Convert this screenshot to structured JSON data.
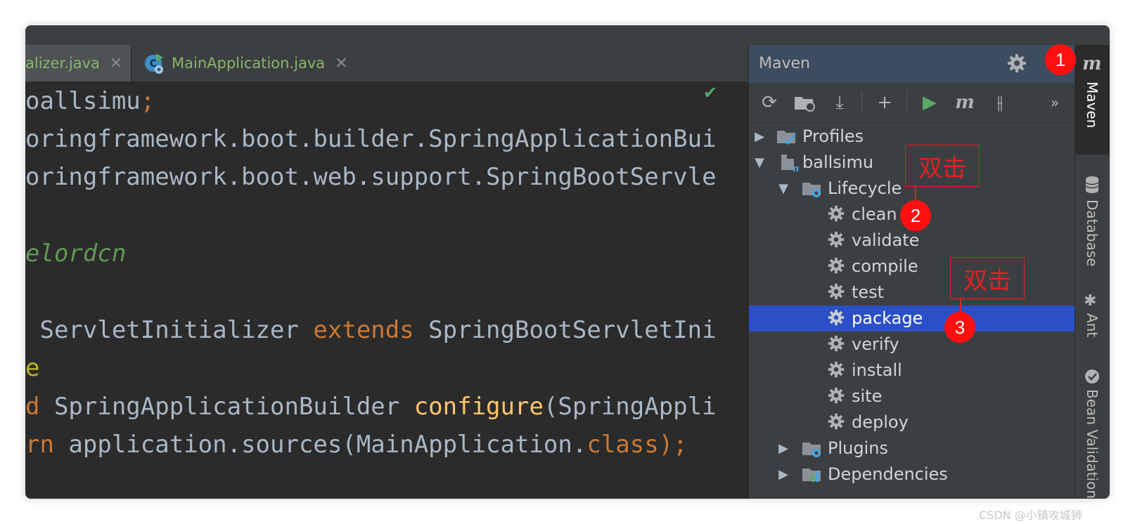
{
  "editor": {
    "tabs": [
      {
        "label": "alizer.java",
        "close": "✕"
      },
      {
        "label": "MainApplication.java",
        "close": "✕"
      }
    ],
    "status_check": "✔",
    "lines": {
      "l1_a": "oallsimu",
      "l1_b": ";",
      "l2": "oringframework.boot.builder.SpringApplicationBui",
      "l3": "oringframework.boot.web.support.SpringBootServle",
      "l5": "elordcn",
      "l7_a": " ServletInitializer ",
      "l7_b": "extends",
      "l7_c": " SpringBootServletIni",
      "l8": "e",
      "l9_a": "d",
      "l9_b": " SpringApplicationBuilder ",
      "l9_c": "configure",
      "l9_d": "(SpringAppli",
      "l10_a": "rn",
      "l10_b": " application.sources(MainApplication.",
      "l10_c": "class",
      "l10_d": ");"
    }
  },
  "maven": {
    "title": "Maven",
    "settings_icon": "gear-icon",
    "toolbar": [
      {
        "icon": "reload-icon",
        "glyph": "⟳"
      },
      {
        "icon": "folder-reload-icon",
        "glyph": ""
      },
      {
        "icon": "download-icon",
        "glyph": "⤓"
      },
      {
        "icon": "add-icon",
        "glyph": "+"
      },
      {
        "icon": "run-icon",
        "glyph": "▶"
      },
      {
        "icon": "maven-goal-icon",
        "glyph": "m"
      },
      {
        "icon": "toggle-offline-icon",
        "glyph": "⫲"
      },
      {
        "icon": "more-icon",
        "glyph": "»"
      }
    ],
    "tree": {
      "profiles": "Profiles",
      "project": "ballsimu",
      "lifecycle": "Lifecycle",
      "goals": [
        "clean",
        "validate",
        "compile",
        "test",
        "package",
        "verify",
        "install",
        "site",
        "deploy"
      ],
      "selected_goal": "package",
      "plugins": "Plugins",
      "dependencies": "Dependencies"
    }
  },
  "right_strip": {
    "tabs": [
      "Maven",
      "Database",
      "Ant",
      "Bean Validation"
    ]
  },
  "annotations": {
    "callout_1": "双击",
    "callout_2": "双击",
    "badge_1": "1",
    "badge_2": "2",
    "badge_3": "3"
  },
  "watermark": "CSDN @小镇攻城狮",
  "colors": {
    "selection": "#2b4fc6",
    "annotation_red": "#e02020",
    "badge_red": "#ff1010",
    "keyword_orange": "#cc7832",
    "comment_green": "#629755"
  }
}
